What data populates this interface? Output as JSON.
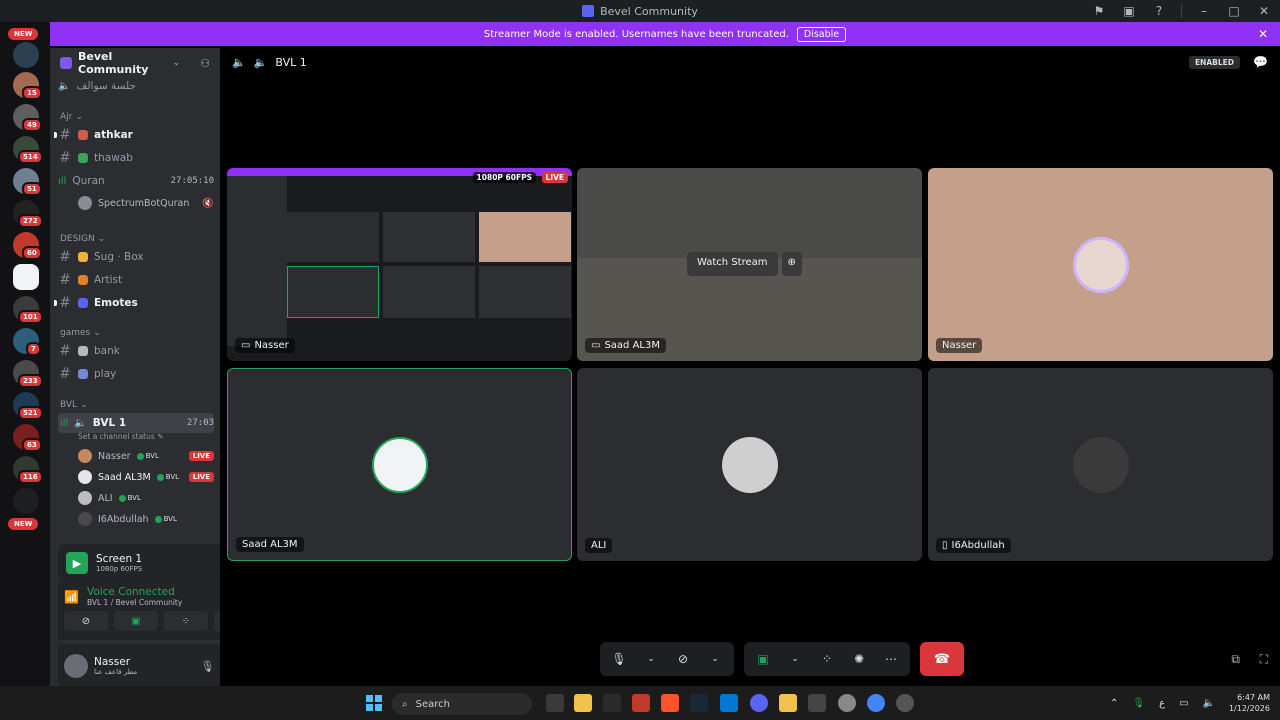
{
  "window": {
    "title": "Bevel Community"
  },
  "banner": {
    "text": "Streamer Mode is enabled. Usernames have been truncated.",
    "disable_label": "Disable"
  },
  "rail": {
    "new_top": "NEW",
    "new_bottom": "NEW",
    "badges": [
      "15",
      "49",
      "514",
      "51",
      "272",
      "60",
      "101",
      "7",
      "233",
      "521",
      "63",
      "116"
    ]
  },
  "guild": {
    "name": "Bevel Community"
  },
  "channels": {
    "voice_arabic": "جلسة سوالف",
    "cat_ajr": "Ajr",
    "athkar": "athkar",
    "thawab": "thawab",
    "quran": "Quran",
    "quran_time": "27:05:10",
    "quran_bot": "SpectrumBotQuran",
    "cat_design": "DESIGN",
    "sug_box": "Sug · Box",
    "artist": "Artist",
    "emotes": "Emotes",
    "cat_games": "games",
    "bank": "bank",
    "play": "play",
    "cat_bvl": "BVL",
    "bvl1": "BVL 1",
    "bvl1_time": "27:03",
    "bvl1_status": "Set a channel status"
  },
  "voice_users": [
    {
      "name": "Nasser",
      "tag": "BVL",
      "live": "LIVE"
    },
    {
      "name": "Saad AL3M",
      "tag": "BVL",
      "live": "LIVE"
    },
    {
      "name": "ALI",
      "tag": "BVL",
      "live": ""
    },
    {
      "name": "I6Abdullah",
      "tag": "BVL",
      "live": ""
    }
  ],
  "screen_panel": {
    "title": "Screen 1",
    "quality": "1080p 60FPS"
  },
  "voice_panel": {
    "status": "Voice Connected",
    "location": "BVL 1 / Bevel Community"
  },
  "user_panel": {
    "name": "Nasser",
    "status": "مطر فاعف عنا"
  },
  "stage": {
    "channel": "BVL 1",
    "enabled_label": "ENABLED",
    "stream_badge": "1080P 60FPS",
    "live_badge": "LIVE",
    "watch_stream": "Watch Stream",
    "tiles": [
      "Nasser",
      "Saad AL3M",
      "Nasser",
      "Saad AL3M",
      "ALI",
      "I6Abdullah"
    ]
  },
  "taskbar": {
    "search_placeholder": "Search",
    "time": "6:47 AM",
    "date": "1/12/2026",
    "lang": "ع"
  },
  "colors": {
    "accent": "#5865f2",
    "banner": "#8f32f5",
    "live": "#da373c",
    "connected": "#23a559"
  }
}
